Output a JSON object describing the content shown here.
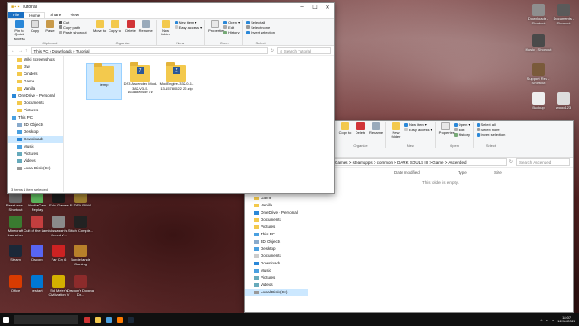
{
  "desktop": {
    "left_icons": [
      {
        "label": "",
        "color": "#ffffff"
      },
      {
        "label": "",
        "color": "#e6e6e6"
      },
      {
        "label": "",
        "color": "#2c7be5"
      },
      {
        "label": "",
        "color": "#ff7a00"
      },
      {
        "label": "",
        "color": "#3da35d"
      },
      {
        "label": "",
        "color": "#c33"
      },
      {
        "label": "",
        "color": "#2c7be5"
      },
      {
        "label": "",
        "color": "#000000"
      }
    ],
    "bottom_icons": [
      {
        "label": "Reset.exe - Shortcut",
        "color": "#6c6c6c"
      },
      {
        "label": "NvidiaCam Replay",
        "color": "#5cb85c"
      },
      {
        "label": "Epic Games",
        "color": "#1b1b1b"
      },
      {
        "label": "Tekken 7",
        "color": "#333333"
      },
      {
        "label": "ELDEN RING",
        "color": "#a08030"
      },
      {
        "label": "Minecraft Launcher",
        "color": "#3a7a30"
      },
      {
        "label": "Cult of the Lamb",
        "color": "#c43e3e"
      },
      {
        "label": "Assassin's Creed V...",
        "color": "#8a8a8a"
      },
      {
        "label": "Stitch Comple...",
        "color": "#222222"
      },
      {
        "label": "Steam",
        "color": "#1b2838"
      },
      {
        "label": "Discord",
        "color": "#5865f2"
      },
      {
        "label": "Far Cry 6",
        "color": "#cc2222"
      },
      {
        "label": "Borderlands Gaming",
        "color": "#b8802a"
      },
      {
        "label": "TeamViewer",
        "color": "#ffffff"
      },
      {
        "label": "Office",
        "color": "#d83b01"
      },
      {
        "label": "restart",
        "color": "#0078d4"
      },
      {
        "label": "Sid Meier's Civilization V",
        "color": "#d4b000"
      },
      {
        "label": "Dragon's Dogma Da...",
        "color": "#8c2b2b"
      }
    ],
    "right_icons": [
      {
        "label": "Downloads - Shortcut",
        "color": "#8e8e8e"
      },
      {
        "label": "Documents - Shortcut",
        "color": "#5a5a5a"
      },
      {
        "label": "Music - Shortcut",
        "color": "#4a4a4a"
      },
      {
        "label": "Support Res - Shortcut",
        "color": "#7a5a3a"
      },
      {
        "label": "Backup",
        "color": "#eeeeee"
      },
      {
        "label": "wooo123",
        "color": "#dddddd"
      }
    ]
  },
  "window_front": {
    "title": "Tutorial",
    "tabs": [
      "File",
      "Home",
      "Share",
      "View"
    ],
    "clipboard": {
      "pin_label": "Pin to Quick access",
      "copy_label": "Copy",
      "paste_label": "Paste",
      "cut_label": "Cut",
      "copy_path_label": "Copy path",
      "paste_shortcut_label": "Paste shortcut",
      "group_name": "Clipboard"
    },
    "organize": {
      "move_label": "Move to",
      "copy_to_label": "Copy to",
      "delete_label": "Delete",
      "rename_label": "Rename",
      "group_name": "Organize"
    },
    "new": {
      "new_folder_label": "New folder",
      "new_item_label": "New item",
      "easy_access_label": "Easy access",
      "group_name": "New"
    },
    "open": {
      "properties_label": "Properties",
      "open_label": "Open",
      "edit_label": "Edit",
      "history_label": "History",
      "group_name": "Open"
    },
    "select": {
      "select_all_label": "Select all",
      "select_none_label": "Select none",
      "invert_label": "Invert selection",
      "group_name": "Select"
    },
    "address": [
      "This PC",
      "Downloads",
      "Tutorial"
    ],
    "search_placeholder": "Search Tutorial",
    "nav_items": [
      {
        "label": "Wiki Screenshots"
      },
      {
        "label": "ctw"
      },
      {
        "label": "Cinders"
      },
      {
        "label": "Game"
      },
      {
        "label": "Vanilla"
      },
      {
        "label": "OneDrive - Personal"
      },
      {
        "label": "Documents"
      },
      {
        "label": "Pictures"
      },
      {
        "label": "This PC"
      },
      {
        "label": "3D Objects"
      },
      {
        "label": "Desktop"
      },
      {
        "label": "Downloads"
      },
      {
        "label": "Music"
      },
      {
        "label": "Pictures"
      },
      {
        "label": "Videos"
      },
      {
        "label": "Local Disk (C:)"
      }
    ],
    "files": [
      {
        "name": "temp",
        "kind": "folder"
      },
      {
        "name": "DS3 Ascended Mod-382-V3-5-1638899450 7z",
        "kind": "archive"
      },
      {
        "name": "ModEngine-332-0-1-13-15780522 22.zip",
        "kind": "archive"
      }
    ],
    "status": "3 items    1 item selected"
  },
  "window_back": {
    "title": "",
    "clipboard": {
      "copy_to_label": "Copy to",
      "group_name": "Organize"
    },
    "organize": {
      "delete_label": "Delete",
      "rename_label": "Rename"
    },
    "new": {
      "new_folder_label": "New folder",
      "new_item_label": "New item",
      "easy_access_label": "Easy access",
      "group_name": "New"
    },
    "open": {
      "properties_label": "Properties",
      "open_label": "Open",
      "edit_label": "Edit",
      "history_label": "History",
      "group_name": "Open"
    },
    "select": {
      "select_all_label": "Select all",
      "select_none_label": "Select none",
      "invert_label": "Invert selection",
      "group_name": "Select"
    },
    "address": "Games > steamapps > common > DARK SOULS III > Game > Ascended",
    "search_placeholder": "Search Ascended",
    "columns": [
      "Date modified",
      "Type",
      "Size"
    ],
    "empty_text": "This folder is empty.",
    "nav_items": [
      {
        "label": "Game"
      },
      {
        "label": "Vanilla"
      },
      {
        "label": "OneDrive - Personal"
      },
      {
        "label": "Documents"
      },
      {
        "label": "Pictures"
      },
      {
        "label": "This PC"
      },
      {
        "label": "3D Objects"
      },
      {
        "label": "Desktop"
      },
      {
        "label": "Documents"
      },
      {
        "label": "Downloads"
      },
      {
        "label": "Music"
      },
      {
        "label": "Pictures"
      },
      {
        "label": "Videos"
      },
      {
        "label": "Local Disk (C:)"
      }
    ]
  },
  "taskbar": {
    "time": "18:07",
    "date": "12/11/2023"
  }
}
